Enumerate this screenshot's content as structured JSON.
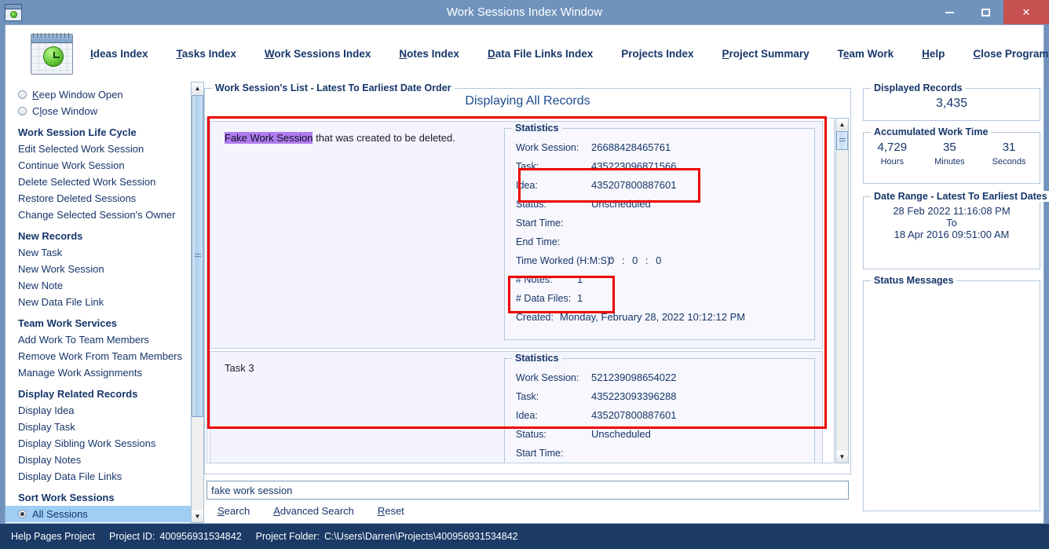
{
  "window": {
    "title": "Work Sessions Index Window",
    "app_icon": "calendar-clock-icon",
    "minimize": "–",
    "maximize": "□",
    "close": "✕"
  },
  "nav": {
    "logo_icon": "calendar-clock-logo",
    "items": [
      {
        "label": "Ideas Index",
        "accel": "I"
      },
      {
        "label": "Tasks Index",
        "accel": "T"
      },
      {
        "label": "Work Sessions Index",
        "accel": "W"
      },
      {
        "label": "Notes Index",
        "accel": "N"
      },
      {
        "label": "Data File Links Index",
        "accel": "D"
      },
      {
        "label": "Projects Index",
        "accel": "P"
      },
      {
        "label": "Project Summary",
        "accel": "P"
      },
      {
        "label": "Team Work",
        "accel": "e"
      },
      {
        "label": "Help",
        "accel": "H"
      },
      {
        "label": "Close Program",
        "accel": "C"
      }
    ]
  },
  "sidebar": {
    "radios": [
      {
        "label": "Keep Window Open",
        "accel": "K",
        "selected": false
      },
      {
        "label": "Close Window",
        "accel": "l",
        "selected": false
      }
    ],
    "groups": [
      {
        "heading": "Work Session Life Cycle",
        "items": [
          "Edit Selected Work Session",
          "Continue Work Session",
          "Delete Selected Work Session",
          "Restore Deleted Sessions",
          "Change Selected Session's Owner"
        ]
      },
      {
        "heading": "New Records",
        "items": [
          "New Task",
          "New Work Session",
          "New Note",
          "New Data File Link"
        ]
      },
      {
        "heading": "Team Work Services",
        "items": [
          "Add Work To Team Members",
          "Remove Work From Team Members",
          "Manage Work Assignments"
        ]
      },
      {
        "heading": "Display Related Records",
        "items": [
          "Display Idea",
          "Display Task",
          "Display Sibling Work Sessions",
          "Display Notes",
          "Display Data File Links"
        ]
      }
    ],
    "sort_heading": "Sort Work Sessions",
    "sort_options": [
      {
        "label": "All Sessions",
        "selected": true
      }
    ]
  },
  "main": {
    "list_legend": "Work Session's List - Latest To Earliest Date Order",
    "displaying": "Displaying All Records",
    "stats_legend": "Statistics",
    "records": [
      {
        "title_highlight": "Fake Work Session",
        "title_rest": " that was created to be deleted.",
        "highlighted": true,
        "stats": {
          "work_session_label": "Work Session:",
          "work_session": "26688428465761",
          "task_label": "Task:",
          "task": "435223096871566",
          "idea_label": "Idea:",
          "idea": "435207800887601",
          "status_label": "Status:",
          "status": "Unscheduled",
          "start_label": "Start Time:",
          "start": "",
          "end_label": "End Time:",
          "end": "",
          "time_worked_label": "Time Worked (H:M:S):",
          "time_worked": "0  :  0  :  0",
          "notes_label": "# Notes:",
          "notes": "1",
          "datafiles_label": "# Data Files:",
          "datafiles": "1",
          "created_label": "Created:",
          "created": "Monday, February 28, 2022   10:12:12 PM"
        }
      },
      {
        "title_highlight": "",
        "title_rest": "Task 3",
        "highlighted": false,
        "stats": {
          "work_session_label": "Work Session:",
          "work_session": "521239098654022",
          "task_label": "Task:",
          "task": "435223093396288",
          "idea_label": "Idea:",
          "idea": "435207800887601",
          "status_label": "Status:",
          "status": "Unscheduled",
          "start_label": "Start Time:",
          "start": ""
        }
      }
    ]
  },
  "search": {
    "value": "fake work session",
    "placeholder": "",
    "links": [
      {
        "label": "Search",
        "accel": "S"
      },
      {
        "label": "Advanced Search",
        "accel": "A"
      },
      {
        "label": "Reset",
        "accel": "R"
      }
    ]
  },
  "right": {
    "displayed_records": {
      "legend": "Displayed Records",
      "value": "3,435"
    },
    "accumulated": {
      "legend": "Accumulated Work Time",
      "hours": "4,729",
      "hours_unit": "Hours",
      "minutes": "35",
      "minutes_unit": "Minutes",
      "seconds": "31",
      "seconds_unit": "Seconds"
    },
    "date_range": {
      "legend": "Date Range - Latest To Earliest Dates",
      "from": "28 Feb 2022  11:16:08 PM",
      "to_label": "To",
      "to": "18 Apr 2016  09:51:00 AM"
    },
    "status_messages": {
      "legend": "Status Messages",
      "body": ""
    }
  },
  "statusbar": {
    "project": "Help Pages Project",
    "project_id_label": "Project ID:",
    "project_id": "400956931534842",
    "folder_label": "Project Folder:",
    "folder": "C:\\Users\\Darren\\Projects\\400956931534842"
  },
  "colors": {
    "title_bar": "#6f93bd",
    "close": "#c75050",
    "accent": "#16366a",
    "highlight_box": "#ee0000",
    "text_highlight": "#b07cf0",
    "status_bar": "#1b3a66"
  }
}
